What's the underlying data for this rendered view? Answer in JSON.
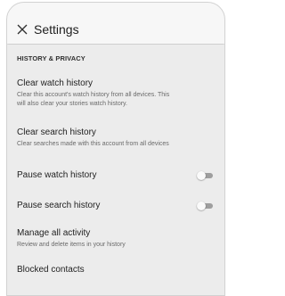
{
  "appbar": {
    "title": "Settings",
    "close_icon": "close-icon"
  },
  "section": {
    "header": "HISTORY & PRIVACY"
  },
  "items": [
    {
      "label": "Clear watch history",
      "description": "Clear this account's watch history from all devices. This\nwill also clear your stories watch history."
    },
    {
      "label": "Clear search history",
      "description": "Clear searches made with this account from all devices"
    },
    {
      "label": "Pause watch history",
      "toggle_state": "off"
    },
    {
      "label": "Pause search history",
      "toggle_state": "off"
    },
    {
      "label": "Manage all activity",
      "description": "Review and delete items in your history"
    },
    {
      "label": "Blocked contacts"
    }
  ],
  "colors": {
    "background": "#ececec",
    "appbar": "#f7f7f7",
    "toggle_off_track": "#9e9e9e",
    "toggle_off_thumb": "#fafafa"
  }
}
